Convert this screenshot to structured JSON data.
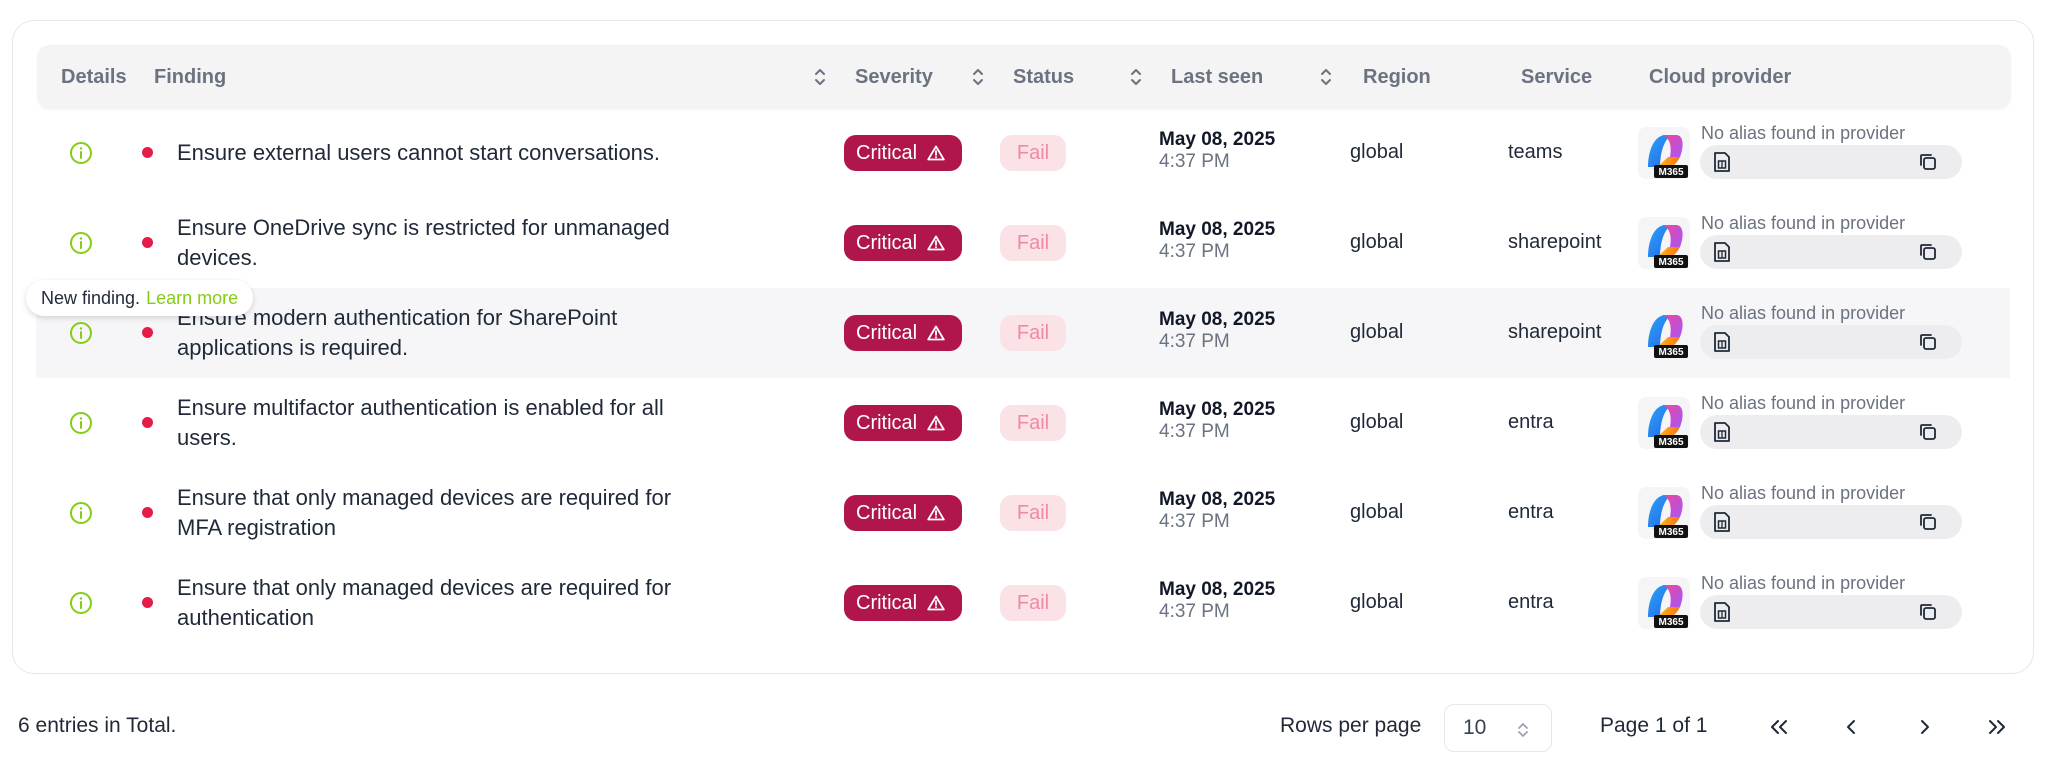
{
  "table": {
    "headers": {
      "details": "Details",
      "finding": "Finding",
      "severity": "Severity",
      "status": "Status",
      "last_seen": "Last seen",
      "region": "Region",
      "service": "Service",
      "cloud_provider": "Cloud provider"
    },
    "rows": [
      {
        "finding_line1": "Ensure external users cannot start conversations.",
        "finding_line2": "",
        "severity": "Critical",
        "status": "Fail",
        "date": "May 08, 2025",
        "time": "4:37 PM",
        "region": "global",
        "service": "teams",
        "alias": "No alias found in provider"
      },
      {
        "finding_line1": "Ensure OneDrive sync is restricted for unmanaged",
        "finding_line2": "devices.",
        "severity": "Critical",
        "status": "Fail",
        "date": "May 08, 2025",
        "time": "4:37 PM",
        "region": "global",
        "service": "sharepoint",
        "alias": "No alias found in provider"
      },
      {
        "finding_line1": "Ensure modern authentication for SharePoint",
        "finding_line2": "applications is required.",
        "severity": "Critical",
        "status": "Fail",
        "date": "May 08, 2025",
        "time": "4:37 PM",
        "region": "global",
        "service": "sharepoint",
        "alias": "No alias found in provider"
      },
      {
        "finding_line1": "Ensure multifactor authentication is enabled for all",
        "finding_line2": "users.",
        "severity": "Critical",
        "status": "Fail",
        "date": "May 08, 2025",
        "time": "4:37 PM",
        "region": "global",
        "service": "entra",
        "alias": "No alias found in provider"
      },
      {
        "finding_line1": "Ensure that only managed devices are required for",
        "finding_line2": "MFA registration",
        "severity": "Critical",
        "status": "Fail",
        "date": "May 08, 2025",
        "time": "4:37 PM",
        "region": "global",
        "service": "entra",
        "alias": "No alias found in provider"
      },
      {
        "finding_line1": "Ensure that only managed devices are required for",
        "finding_line2": "authentication",
        "severity": "Critical",
        "status": "Fail",
        "date": "May 08, 2025",
        "time": "4:37 PM",
        "region": "global",
        "service": "entra",
        "alias": "No alias found in provider"
      }
    ],
    "provider_badge": "M365"
  },
  "tooltip": {
    "text": "New finding.",
    "link": "Learn more"
  },
  "footer": {
    "total": "6 entries in Total.",
    "rows_per_page_label": "Rows per page",
    "rows_per_page_value": "10",
    "page_info": "Page 1 of 1"
  },
  "icons": {
    "details": "info-circle-icon",
    "severity": "warning-triangle-icon",
    "alias": "sim-card-icon",
    "copy": "copy-icon",
    "sort": "sort-updown-icon",
    "first": "chevrons-left-icon",
    "prev": "chevron-left-icon",
    "next": "chevron-right-icon",
    "last": "chevrons-right-icon"
  },
  "colors": {
    "critical": "#b0164b",
    "fail_bg": "#fbe2e7",
    "fail_text": "#f08aa0",
    "dot": "#e11d48",
    "details_icon": "#84cc16"
  }
}
